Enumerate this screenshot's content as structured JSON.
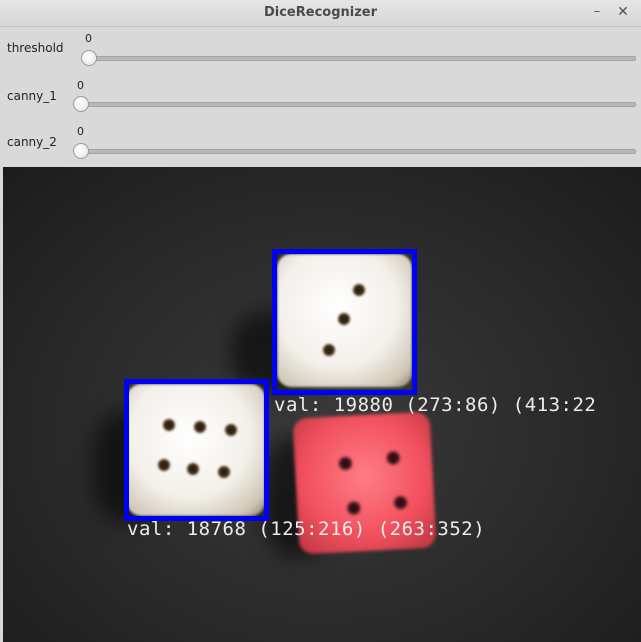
{
  "window": {
    "title": "DiceRecognizer",
    "minimize_glyph": "–",
    "close_glyph": "✕"
  },
  "sliders": [
    {
      "label": "threshold",
      "value": "0",
      "fraction": 0
    },
    {
      "label": "canny_1",
      "value": "0",
      "fraction": 0
    },
    {
      "label": "canny_2",
      "value": "0",
      "fraction": 0
    }
  ],
  "detections": [
    {
      "label": "val: 19880 (273:86) (413:22"
    },
    {
      "label": "val: 18768 (125:216) (263:352)"
    }
  ],
  "colors": {
    "bbox": "#0000f5",
    "die_white": "#f3f0ea",
    "die_red": "#f1505d"
  }
}
